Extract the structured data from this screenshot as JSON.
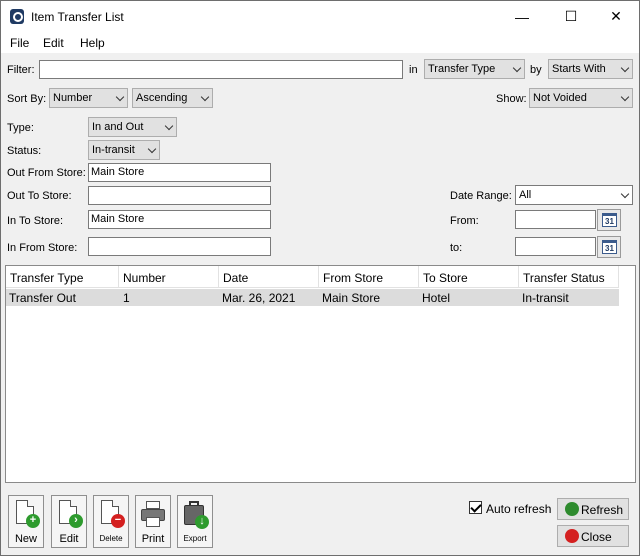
{
  "window": {
    "title": "Item Transfer List",
    "minimize": "—",
    "maximize": "☐",
    "close": "✕"
  },
  "menu": [
    "File",
    "Edit",
    "Help"
  ],
  "filter": {
    "label": "Filter:",
    "value": "",
    "in_label": "in",
    "in_value": "Transfer Type",
    "by_label": "by",
    "by_value": "Starts With"
  },
  "sort": {
    "label": "Sort By:",
    "field": "Number",
    "order": "Ascending"
  },
  "show": {
    "label": "Show:",
    "value": "Not Voided"
  },
  "type": {
    "label": "Type:",
    "value": "In and Out"
  },
  "status": {
    "label": "Status:",
    "value": "In-transit"
  },
  "out_from_store": {
    "label": "Out From Store:",
    "value": "Main Store"
  },
  "out_to_store": {
    "label": "Out To Store:",
    "value": ""
  },
  "in_to_store": {
    "label": "In To Store:",
    "value": "Main Store"
  },
  "in_from_store": {
    "label": "In From Store:",
    "value": ""
  },
  "date_range": {
    "label": "Date Range:",
    "value": "All",
    "from_label": "From:",
    "to_label": "to:",
    "from_value": "",
    "to_value": "",
    "cal_text": "31"
  },
  "grid": {
    "columns": [
      "Transfer Type",
      "Number",
      "Date",
      "From Store",
      "To Store",
      "Transfer Status"
    ],
    "rows": [
      [
        "Transfer Out",
        "1",
        "Mar. 26, 2021",
        "Main Store",
        "Hotel",
        "In-transit"
      ]
    ]
  },
  "toolbar": {
    "new": "New",
    "edit": "Edit",
    "delete": "Delete",
    "print": "Print",
    "export": "Export"
  },
  "auto_refresh": {
    "label": "Auto refresh",
    "checked": true
  },
  "buttons": {
    "refresh": "Refresh",
    "close": "Close"
  }
}
